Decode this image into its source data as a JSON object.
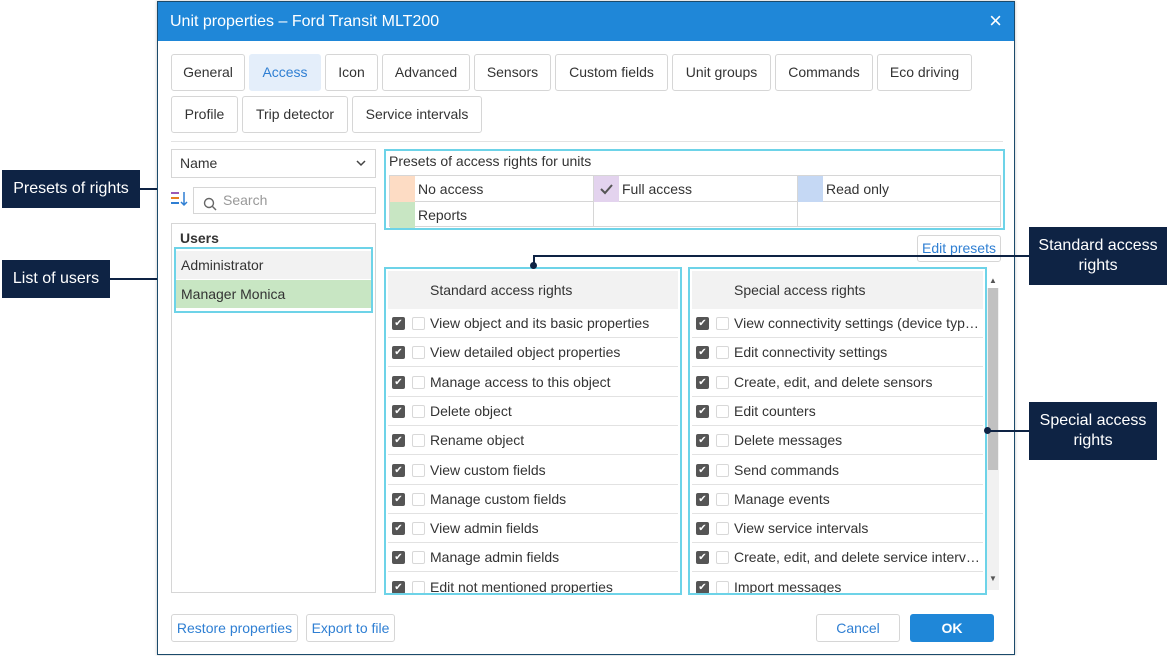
{
  "dialog": {
    "title": "Unit properties – Ford Transit MLT200",
    "close_glyph": "×"
  },
  "tabs": [
    {
      "label": "General",
      "active": false
    },
    {
      "label": "Access",
      "active": true
    },
    {
      "label": "Icon",
      "active": false
    },
    {
      "label": "Advanced",
      "active": false
    },
    {
      "label": "Sensors",
      "active": false
    },
    {
      "label": "Custom fields",
      "active": false
    },
    {
      "label": "Unit groups",
      "active": false
    },
    {
      "label": "Commands",
      "active": false
    },
    {
      "label": "Eco driving",
      "active": false
    },
    {
      "label": "Profile",
      "active": false
    },
    {
      "label": "Trip detector",
      "active": false
    },
    {
      "label": "Service intervals",
      "active": false
    }
  ],
  "sort_select": {
    "value": "Name"
  },
  "search": {
    "placeholder": "Search"
  },
  "users": {
    "header": "Users",
    "items": [
      "Administrator",
      "Manager Monica"
    ]
  },
  "presets": {
    "title": "Presets of access rights for units",
    "items": [
      {
        "label": "No access",
        "color": "#fddcc4",
        "checked": false
      },
      {
        "label": "Full access",
        "color": "#e3d3ee",
        "checked": true
      },
      {
        "label": "Read only",
        "color": "#c5d8f4",
        "checked": false
      },
      {
        "label": "Reports",
        "color": "#c8e6c3",
        "checked": false
      }
    ],
    "edit_label": "Edit presets"
  },
  "standard_rights": {
    "header": "Standard access rights",
    "items": [
      "View object and its basic properties",
      "View detailed object properties",
      "Manage access to this object",
      "Delete object",
      "Rename object",
      "View custom fields",
      "Manage custom fields",
      "View admin fields",
      "Manage admin fields",
      "Edit not mentioned properties"
    ]
  },
  "special_rights": {
    "header": "Special access rights",
    "items": [
      "View connectivity settings (device type, UID, phone, password)",
      "Edit connectivity settings",
      "Create, edit, and delete sensors",
      "Edit counters",
      "Delete messages",
      "Send commands",
      "Manage events",
      "View service intervals",
      "Create, edit, and delete service intervals",
      "Import messages"
    ]
  },
  "footer": {
    "restore": "Restore properties",
    "export": "Export to file",
    "cancel": "Cancel",
    "ok": "OK"
  },
  "callouts": {
    "presets": "Presets of rights",
    "users": "List of users",
    "standard": "Standard access rights",
    "special": "Special access rights"
  },
  "colors": {
    "title_bar": "#1f87d8",
    "highlight": "#6dd3e8",
    "callout_bg": "#0e2344",
    "active_tab_bg": "#e4eefa",
    "accent_text": "#2f7fd3"
  }
}
